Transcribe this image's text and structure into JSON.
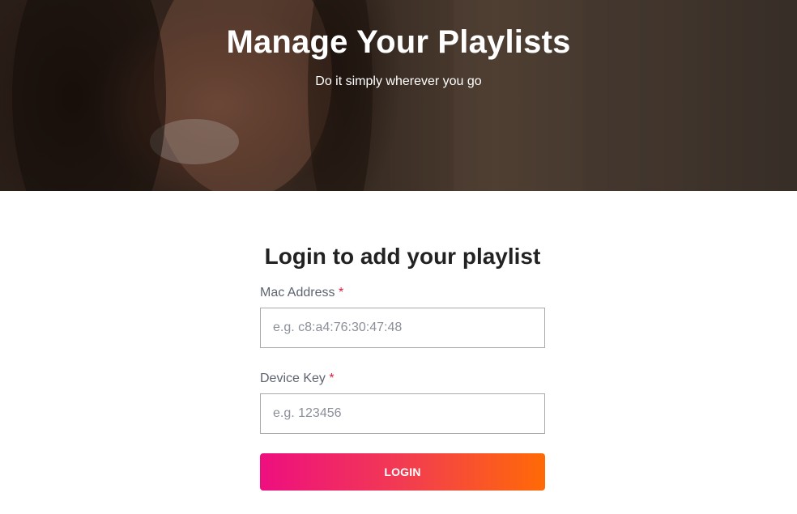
{
  "hero": {
    "title": "Manage Your Playlists",
    "subtitle": "Do it simply wherever you go"
  },
  "login_form": {
    "title": "Login to add your playlist",
    "mac_address": {
      "label": "Mac Address",
      "required_mark": "*",
      "value": "",
      "placeholder": "e.g. c8:a4:76:30:47:48"
    },
    "device_key": {
      "label": "Device Key",
      "required_mark": "*",
      "value": "",
      "placeholder": "e.g. 123456"
    },
    "submit_label": "LOGIN"
  },
  "colors": {
    "button_gradient_start": "#ee0f7f",
    "button_gradient_end": "#ff6a06",
    "required_mark": "#e0203a",
    "label_text": "#5d6470"
  }
}
